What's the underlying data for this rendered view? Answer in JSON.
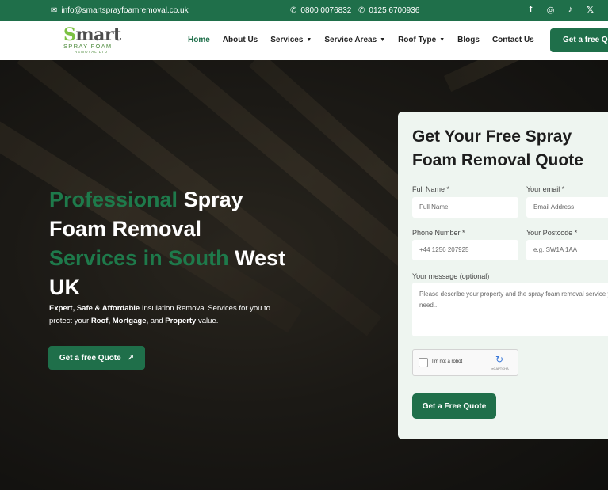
{
  "topbar": {
    "email": "info@smartsprayfoamremoval.co.uk",
    "phone1": "0800 0076832",
    "phone2": "0125 6700936",
    "socials": [
      {
        "icon": "facebook-icon",
        "glyph": "f"
      },
      {
        "icon": "instagram-icon",
        "glyph": "◎"
      },
      {
        "icon": "tiktok-icon",
        "glyph": "♪"
      },
      {
        "icon": "x-icon",
        "glyph": "𝕏"
      }
    ]
  },
  "logo": {
    "line1_a": "S",
    "line1_b": "mart",
    "line2": "SPRAY FOAM",
    "line3": "REMOVAL LTD"
  },
  "nav": {
    "items": [
      {
        "label": "Home",
        "active": true,
        "dropdown": false
      },
      {
        "label": "About Us",
        "active": false,
        "dropdown": false
      },
      {
        "label": "Services",
        "active": false,
        "dropdown": true
      },
      {
        "label": "Service Areas",
        "active": false,
        "dropdown": true
      },
      {
        "label": "Roof Type",
        "active": false,
        "dropdown": true
      },
      {
        "label": "Blogs",
        "active": false,
        "dropdown": false
      },
      {
        "label": "Contact Us",
        "active": false,
        "dropdown": false
      }
    ],
    "cta": "Get a free Quote"
  },
  "hero": {
    "h_g1": "Professional",
    "h_w1": " Spray Foam Removal ",
    "h_g2": "Services in South",
    "h_w2": " West UK",
    "sub_a": "Expert, Safe & Affordable",
    "sub_b": " Insulation Removal Services for you to protect your ",
    "sub_c": "Roof, Mortgage,",
    "sub_d": " and ",
    "sub_e": "Property",
    "sub_f": " value.",
    "cta": "Get a free Quote",
    "cta_icon": "↗"
  },
  "form": {
    "title": "Get Your Free Spray Foam Removal Quote",
    "fullname_label": "Full Name *",
    "fullname_ph": "Full Name",
    "email_label": "Your email *",
    "email_ph": "Email Address",
    "phone_label": "Phone Number *",
    "phone_ph": "+44 1256 207925",
    "postcode_label": "Your Postcode *",
    "postcode_ph": "e.g. SW1A 1AA",
    "message_label": "Your message (optional)",
    "message_ph": "Please describe your property and the spray foam removal service you need...",
    "captcha_text": "I'm not a robot",
    "captcha_brand": "reCAPTCHA",
    "submit": "Get a Free Quote"
  },
  "colors": {
    "brand_green": "#1f6f4a",
    "accent_green": "#1e7a4b",
    "form_bg": "#eef5f0"
  }
}
